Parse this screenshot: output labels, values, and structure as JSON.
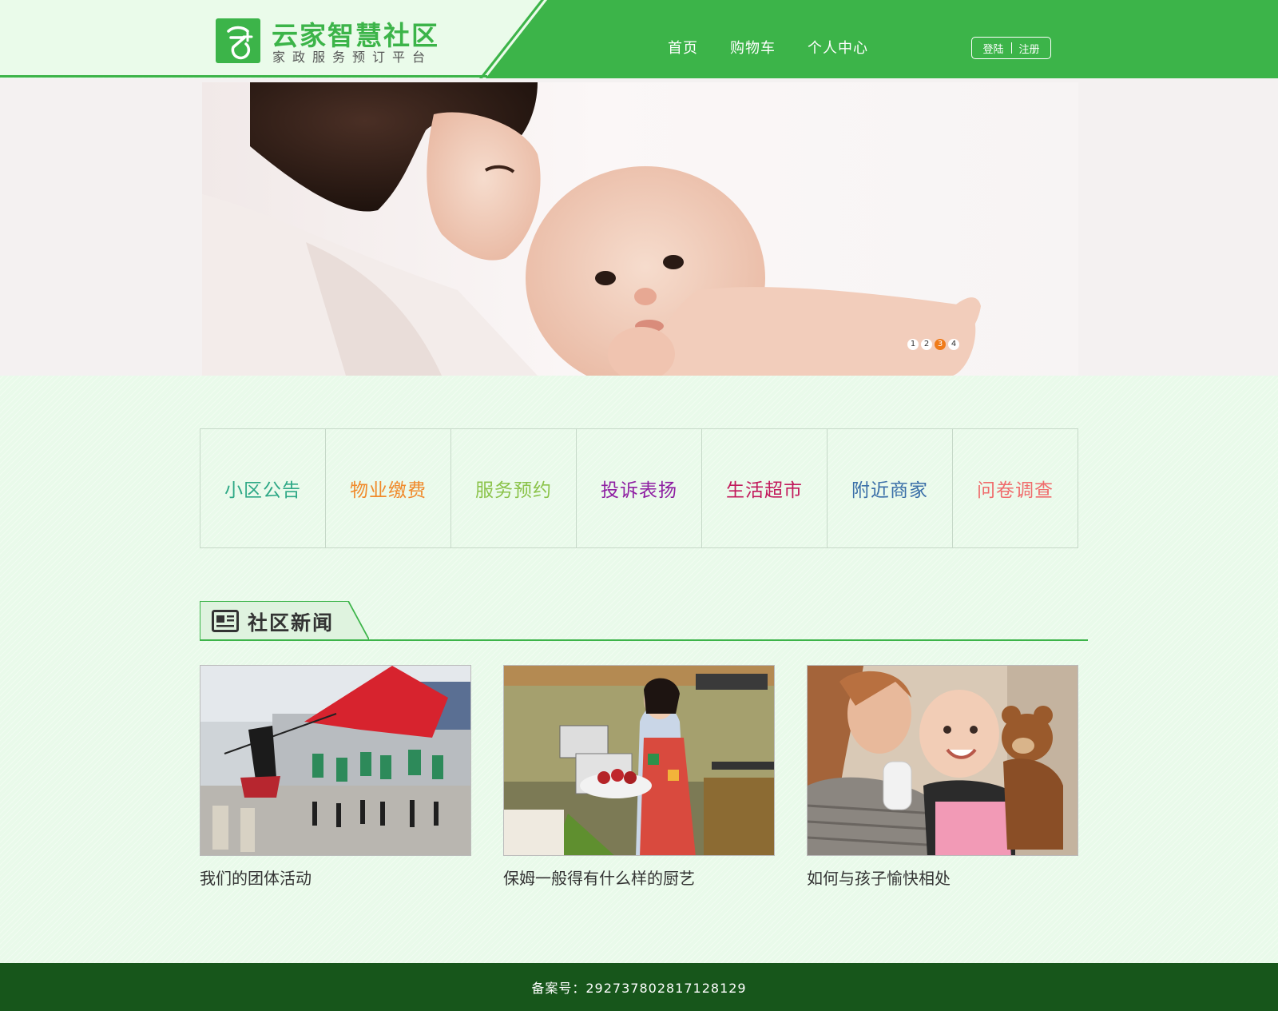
{
  "header": {
    "logo_title": "云家智慧社区",
    "logo_subtitle": "家政服务预订平台",
    "nav": [
      "首页",
      "购物车",
      "个人中心"
    ],
    "login": "登陆",
    "register": "注册",
    "brand_color": "#3cb449"
  },
  "banner": {
    "dots": [
      "1",
      "2",
      "3",
      "4"
    ],
    "active_dot": 3
  },
  "services": [
    {
      "label": "小区公告",
      "color": "#2ea886"
    },
    {
      "label": "物业缴费",
      "color": "#f08a2b"
    },
    {
      "label": "服务预约",
      "color": "#8bc34a"
    },
    {
      "label": "投诉表扬",
      "color": "#8e1fa2"
    },
    {
      "label": "生活超市",
      "color": "#c2185b"
    },
    {
      "label": "附近商家",
      "color": "#3a6fa8"
    },
    {
      "label": "问卷调查",
      "color": "#f06c6c"
    }
  ],
  "news": {
    "title": "社区新闻",
    "icon": "newspaper-icon",
    "items": [
      {
        "title": "我们的团体活动"
      },
      {
        "title": "保姆一般得有什么样的厨艺"
      },
      {
        "title": "如何与孩子愉快相处"
      }
    ]
  },
  "footer": {
    "text": "备案号：292737802817128129"
  }
}
